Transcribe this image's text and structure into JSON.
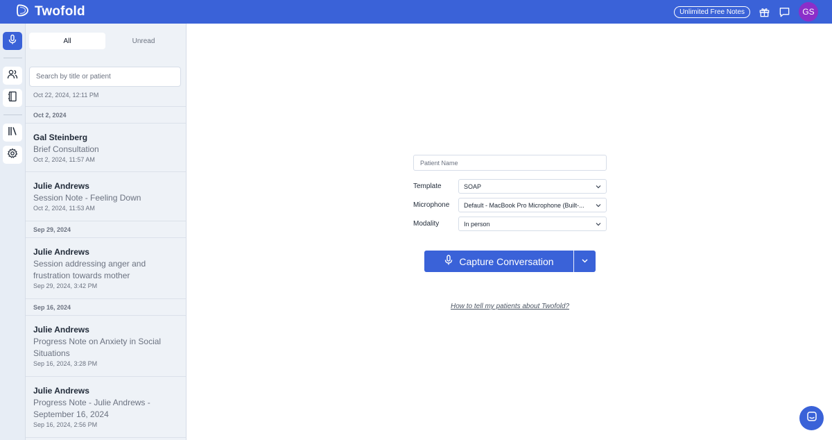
{
  "app": {
    "brand": "Twofold",
    "badge": "Unlimited Free Notes",
    "avatar_initials": "GS",
    "colors": {
      "primary": "#3a62d8",
      "avatar": "#8b2fc9"
    }
  },
  "rail": {
    "icons": [
      "microphone-icon",
      "users-icon",
      "notebook-icon",
      "library-icon",
      "gear-icon"
    ]
  },
  "list_panel": {
    "tabs": [
      "All",
      "Unread"
    ],
    "search_placeholder": "Search by title or patient",
    "top_date": "Oct 22, 2024, 12:11 PM",
    "groups": [
      {
        "date": "Oct 2, 2024",
        "items": [
          {
            "name": "Gal Steinberg",
            "title": "Brief Consultation",
            "time": "Oct 2, 2024, 11:57 AM"
          },
          {
            "name": "Julie Andrews",
            "title": "Session Note - Feeling Down",
            "time": "Oct 2, 2024, 11:53 AM"
          }
        ]
      },
      {
        "date": "Sep 29, 2024",
        "items": [
          {
            "name": "Julie Andrews",
            "title": "Session addressing anger and frustration towards mother",
            "time": "Sep 29, 2024, 3:42 PM"
          }
        ]
      },
      {
        "date": "Sep 16, 2024",
        "items": [
          {
            "name": "Julie Andrews",
            "title": "Progress Note on Anxiety in Social Situations",
            "time": "Sep 16, 2024, 3:28 PM"
          },
          {
            "name": "Julie Andrews",
            "title": "Progress Note - Julie Andrews - September 16, 2024",
            "time": "Sep 16, 2024, 2:56 PM"
          }
        ]
      }
    ]
  },
  "form": {
    "patient_placeholder": "Patient Name",
    "template_label": "Template",
    "template_value": "SOAP",
    "microphone_label": "Microphone",
    "microphone_value": "Default - MacBook Pro Microphone (Built-...",
    "modality_label": "Modality",
    "modality_value": "In person",
    "capture_label": "Capture Conversation",
    "help_link": "How to tell my patients about Twofold?"
  }
}
